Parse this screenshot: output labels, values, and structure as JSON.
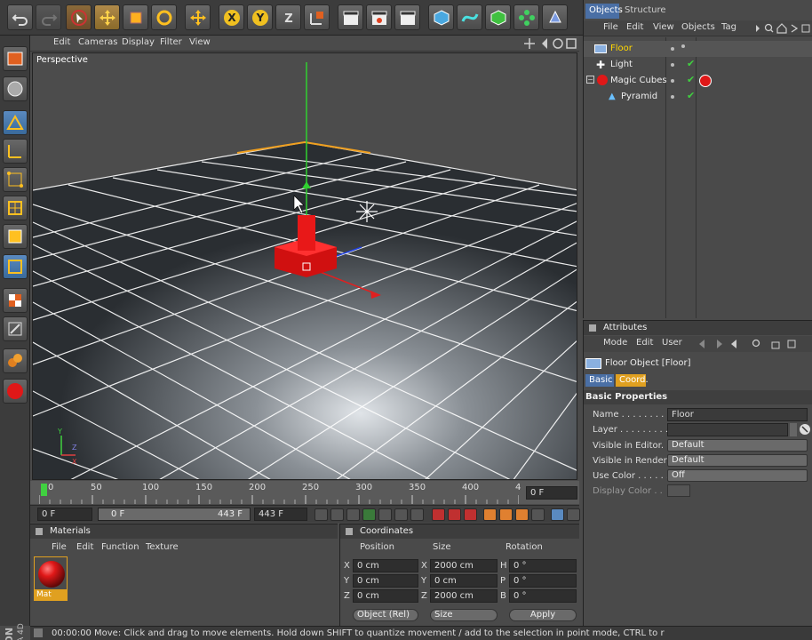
{
  "viewport": {
    "menu": [
      "Edit",
      "Cameras",
      "Display",
      "Filter",
      "View"
    ],
    "label": "Perspective"
  },
  "timeline": {
    "ticks": [
      "0",
      "50",
      "100",
      "150",
      "200",
      "250",
      "300",
      "350",
      "400",
      "4"
    ],
    "current_frame": "0 F"
  },
  "playback": {
    "start": "0 F",
    "min": "0 F",
    "max": "443 F",
    "end": "443 F"
  },
  "materials": {
    "title": "Materials",
    "menu": [
      "File",
      "Edit",
      "Function",
      "Texture"
    ],
    "items": [
      {
        "label": "Mat",
        "color": "#e01818"
      }
    ]
  },
  "coordinates": {
    "title": "Coordinates",
    "headers": [
      "Position",
      "Size",
      "Rotation"
    ],
    "rows": [
      {
        "axis": "X",
        "pos": "0 cm",
        "saxis": "X",
        "size": "2000 cm",
        "raxis": "H",
        "rot": "0 °"
      },
      {
        "axis": "Y",
        "pos": "0 cm",
        "saxis": "Y",
        "size": "0 cm",
        "raxis": "P",
        "rot": "0 °"
      },
      {
        "axis": "Z",
        "pos": "0 cm",
        "saxis": "Z",
        "size": "2000 cm",
        "raxis": "B",
        "rot": "0 °"
      }
    ],
    "mode": "Object (Rel)",
    "size_mode": "Size",
    "apply": "Apply"
  },
  "status": {
    "time": "00:00:00",
    "message": "Move: Click and drag to move elements. Hold down SHIFT to quantize movement / add to the selection in point mode, CTRL to r"
  },
  "objects": {
    "tabs": [
      "Objects",
      "Structure"
    ],
    "menu": [
      "File",
      "Edit",
      "View",
      "Objects",
      "Tag"
    ],
    "items": [
      {
        "name": "Floor",
        "selected": true
      },
      {
        "name": "Light",
        "selected": false
      },
      {
        "name": "Magic Cubes",
        "selected": false
      },
      {
        "name": "Pyramid",
        "selected": false
      }
    ]
  },
  "attributes": {
    "title": "Attributes",
    "menu": [
      "Mode",
      "Edit",
      "User"
    ],
    "object_title": "Floor Object [Floor]",
    "tabs": [
      "Basic",
      "Coord."
    ],
    "section": "Basic Properties",
    "props": [
      {
        "label": "Name . . . . . . . . . .",
        "value": "Floor"
      },
      {
        "label": "Layer . . . . . . . . . .",
        "value": ""
      },
      {
        "label": "Visible in Editor. . .",
        "value": "Default"
      },
      {
        "label": "Visible in Renderer",
        "value": "Default"
      },
      {
        "label": "Use Color . . . . . . .",
        "value": "Off"
      },
      {
        "label": "Display Color . .",
        "value": ""
      }
    ]
  },
  "colors": {
    "accent": "#4a6fa5",
    "selected_text": "#ffd700",
    "red_object": "#e01818"
  }
}
